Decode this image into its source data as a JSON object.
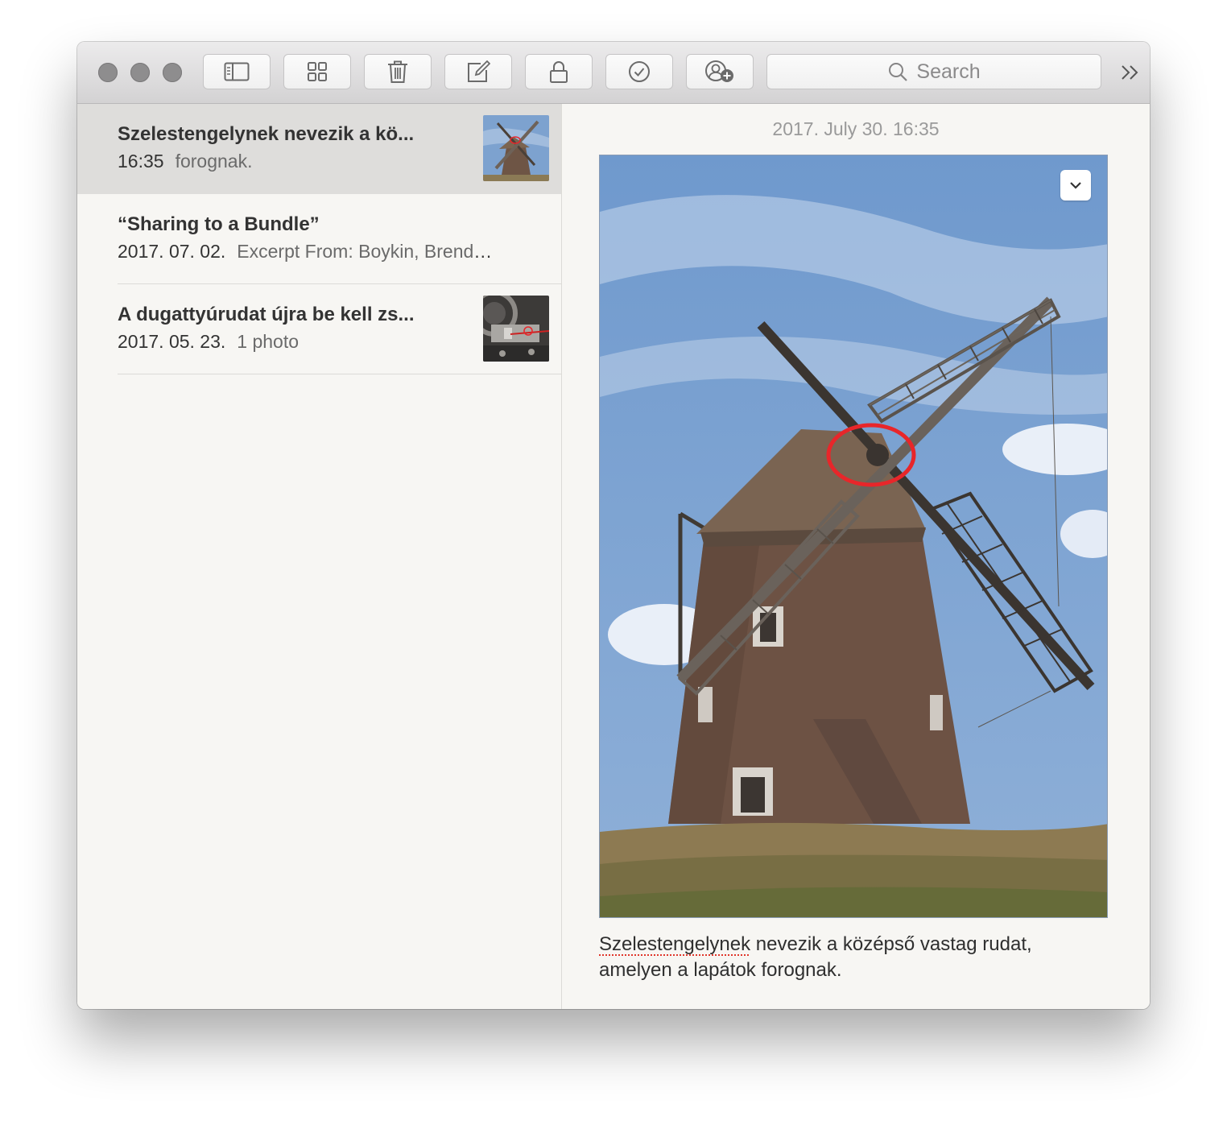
{
  "toolbar": {
    "icons": [
      "sidebar-toggle-icon",
      "gallery-grid-icon",
      "trash-icon",
      "compose-icon",
      "lock-icon",
      "checklist-icon",
      "add-people-icon"
    ],
    "search_placeholder": "Search",
    "overflow_icon": "double-chevron-right-icon"
  },
  "notes": [
    {
      "title": "Szelestengelynek nevezik a kö...",
      "date": "16:35",
      "preview": "forognak.",
      "has_thumbnail": true,
      "selected": true
    },
    {
      "title": "“Sharing to a Bundle”",
      "date": "2017. 07. 02.",
      "preview": "Excerpt From: Boykin, Brenda...",
      "has_thumbnail": false,
      "selected": false
    },
    {
      "title": "A dugattyúrudat újra be kell zs...",
      "date": "2017. 05. 23.",
      "preview": "1 photo",
      "has_thumbnail": true,
      "selected": false
    }
  ],
  "editor": {
    "date_header": "2017. July 30. 16:35",
    "body_misspelled_word": "Szelestengelynek",
    "body_line1_rest": " nevezik a középső vastag rudat,",
    "body_line2": "amelyen a lapátok forognak."
  },
  "colors": {
    "annotation_circle": "#e8262a",
    "selection_background": "#dedddb",
    "spellcheck_underline": "#e0362b"
  }
}
